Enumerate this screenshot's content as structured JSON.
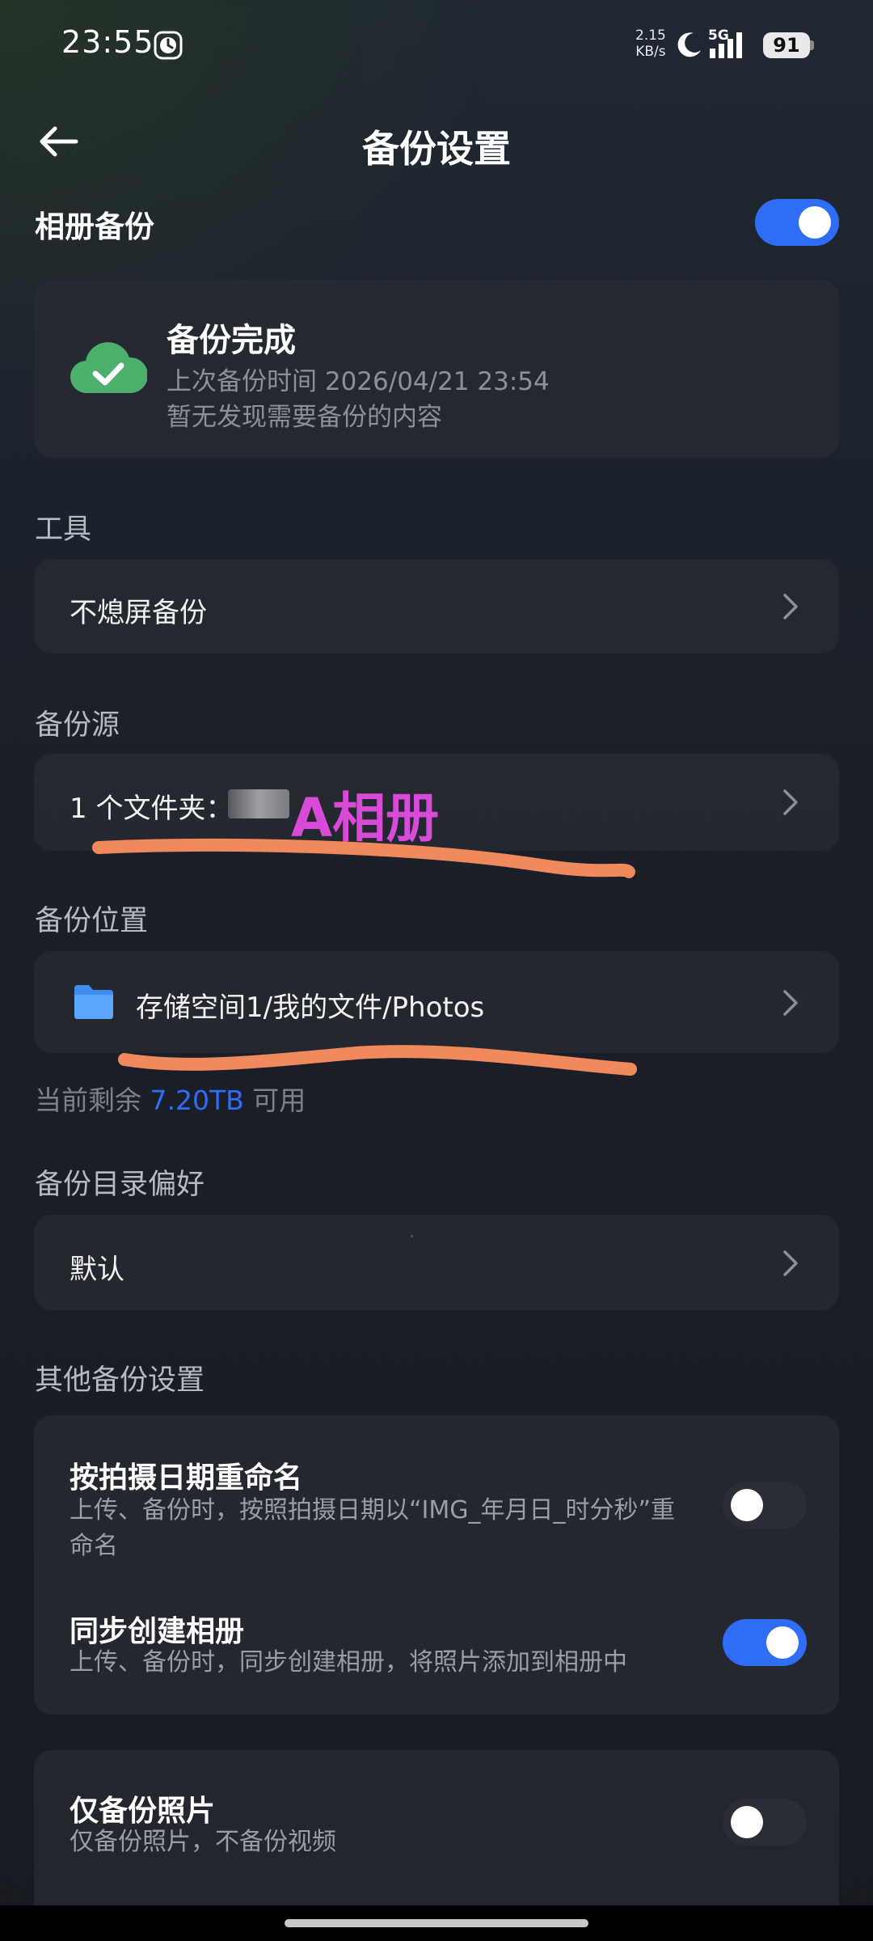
{
  "status_bar": {
    "time": "23:55",
    "net_speed_value": "2.15",
    "net_speed_unit": "KB/s",
    "network": "5G",
    "battery": "91"
  },
  "header": {
    "title": "备份设置"
  },
  "album_backup": {
    "label": "相册备份",
    "enabled": true
  },
  "status_card": {
    "title": "备份完成",
    "last_backup": "上次备份时间 2026/04/21 23:54",
    "note": "暂无发现需要备份的内容"
  },
  "tools": {
    "section_label": "工具",
    "no_sleep_label": "不熄屏备份"
  },
  "source": {
    "section_label": "备份源",
    "folder_text": "1 个文件夹：",
    "handwritten_annotation": "A相册"
  },
  "location": {
    "section_label": "备份位置",
    "path": "存储空间1/我的文件/Photos",
    "free_prefix": "当前剩余",
    "free_value": "7.20TB",
    "free_suffix": "可用"
  },
  "directory_pref": {
    "section_label": "备份目录偏好",
    "value": "默认"
  },
  "other": {
    "section_label": "其他备份设置",
    "rename": {
      "title": "按拍摄日期重命名",
      "desc": "上传、备份时，按照拍摄日期以“IMG_年月日_时分秒”重命名",
      "enabled": false
    },
    "sync_album": {
      "title": "同步创建相册",
      "desc": "上传、备份时，同步创建相册，将照片添加到相册中",
      "enabled": true
    },
    "photos_only": {
      "title": "仅备份照片",
      "desc": "仅备份照片，不备份视频",
      "enabled": false
    }
  },
  "colors": {
    "accent": "#2f6df6",
    "success": "#4caf6b",
    "annotation": "#d84bd8",
    "underline": "#f08a5d"
  }
}
